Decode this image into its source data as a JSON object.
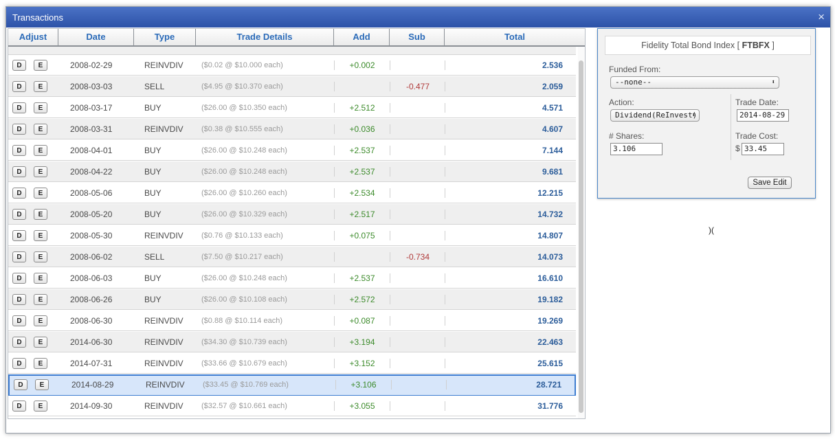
{
  "window": {
    "title": "Transactions",
    "close_glyph": "×"
  },
  "table": {
    "columns": [
      "Adjust",
      "Date",
      "Type",
      "Trade Details",
      "Add",
      "Sub",
      "Total"
    ],
    "delete_label": "D",
    "edit_label": "E",
    "rows": [
      {
        "date": "2008-02-29",
        "type": "REINVDIV",
        "details": "($0.02 @ $10.000 each)",
        "add": "+0.002",
        "sub": "",
        "total": "2.536"
      },
      {
        "date": "2008-03-03",
        "type": "SELL",
        "details": "($4.95 @ $10.370 each)",
        "add": "",
        "sub": "-0.477",
        "total": "2.059"
      },
      {
        "date": "2008-03-17",
        "type": "BUY",
        "details": "($26.00 @ $10.350 each)",
        "add": "+2.512",
        "sub": "",
        "total": "4.571"
      },
      {
        "date": "2008-03-31",
        "type": "REINVDIV",
        "details": "($0.38 @ $10.555 each)",
        "add": "+0.036",
        "sub": "",
        "total": "4.607"
      },
      {
        "date": "2008-04-01",
        "type": "BUY",
        "details": "($26.00 @ $10.248 each)",
        "add": "+2.537",
        "sub": "",
        "total": "7.144"
      },
      {
        "date": "2008-04-22",
        "type": "BUY",
        "details": "($26.00 @ $10.248 each)",
        "add": "+2.537",
        "sub": "",
        "total": "9.681"
      },
      {
        "date": "2008-05-06",
        "type": "BUY",
        "details": "($26.00 @ $10.260 each)",
        "add": "+2.534",
        "sub": "",
        "total": "12.215"
      },
      {
        "date": "2008-05-20",
        "type": "BUY",
        "details": "($26.00 @ $10.329 each)",
        "add": "+2.517",
        "sub": "",
        "total": "14.732"
      },
      {
        "date": "2008-05-30",
        "type": "REINVDIV",
        "details": "($0.76 @ $10.133 each)",
        "add": "+0.075",
        "sub": "",
        "total": "14.807"
      },
      {
        "date": "2008-06-02",
        "type": "SELL",
        "details": "($7.50 @ $10.217 each)",
        "add": "",
        "sub": "-0.734",
        "total": "14.073"
      },
      {
        "date": "2008-06-03",
        "type": "BUY",
        "details": "($26.00 @ $10.248 each)",
        "add": "+2.537",
        "sub": "",
        "total": "16.610"
      },
      {
        "date": "2008-06-26",
        "type": "BUY",
        "details": "($26.00 @ $10.108 each)",
        "add": "+2.572",
        "sub": "",
        "total": "19.182"
      },
      {
        "date": "2008-06-30",
        "type": "REINVDIV",
        "details": "($0.88 @ $10.114 each)",
        "add": "+0.087",
        "sub": "",
        "total": "19.269"
      },
      {
        "date": "2014-06-30",
        "type": "REINVDIV",
        "details": "($34.30 @ $10.739 each)",
        "add": "+3.194",
        "sub": "",
        "total": "22.463"
      },
      {
        "date": "2014-07-31",
        "type": "REINVDIV",
        "details": "($33.66 @ $10.679 each)",
        "add": "+3.152",
        "sub": "",
        "total": "25.615"
      },
      {
        "date": "2014-08-29",
        "type": "REINVDIV",
        "details": "($33.45 @ $10.769 each)",
        "add": "+3.106",
        "sub": "",
        "total": "28.721",
        "selected": true
      },
      {
        "date": "2014-09-30",
        "type": "REINVDIV",
        "details": "($32.57 @ $10.661 each)",
        "add": "+3.055",
        "sub": "",
        "total": "31.776"
      }
    ]
  },
  "editor": {
    "fund_name": "Fidelity Total Bond Index [",
    "fund_symbol": "FTBFX",
    "fund_close": "]",
    "funded_from_label": "Funded From:",
    "funded_from_value": "--none--",
    "action_label": "Action:",
    "action_value": "Dividend(ReInvest)",
    "trade_date_label": "Trade Date:",
    "trade_date_value": "2014-08-29",
    "shares_label": "# Shares:",
    "shares_value": "3.106",
    "trade_cost_label": "Trade Cost:",
    "currency_symbol": "$",
    "trade_cost_value": "33.45",
    "save_label": "Save Edit",
    "select_arrow": "⬍"
  },
  "stray_text": ")("
}
